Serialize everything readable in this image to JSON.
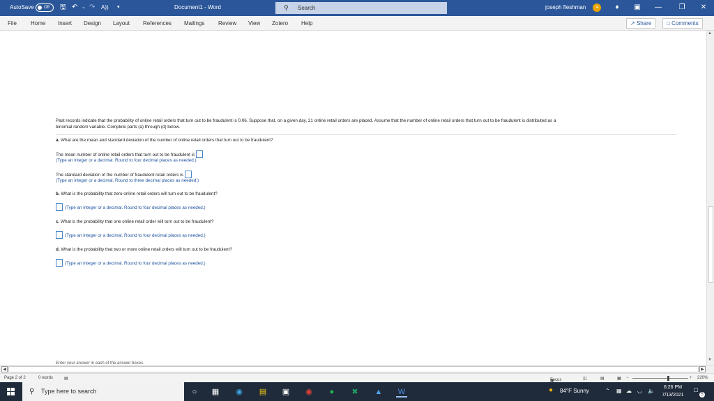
{
  "titlebar": {
    "autosave_label": "AutoSave",
    "autosave_state": "Off",
    "doc_title": "Document1  -  Word",
    "search_label": "Search",
    "user_name": "joseph fleshman",
    "user_initials": "JF"
  },
  "menu": {
    "tabs": [
      "File",
      "Home",
      "Insert",
      "Design",
      "Layout",
      "References",
      "Mailings",
      "Review",
      "View",
      "Zotero",
      "Help"
    ],
    "share_label": "Share",
    "comments_label": "Comments"
  },
  "document": {
    "intro_line1": "Past records indicate that the probability of online retail orders that turn out to be fraudulent is 0.06. Suppose that, on a given day, 21 online retail orders are placed. Assume that the number of online retail orders that turn out to be fraudulent is distributed as a",
    "intro_line2": "binomial random variable. Complete parts (a) through (d) below.",
    "qa_label": "a.",
    "qa_text": "What are the mean and standard deviation of the number of online retail orders that turn out to be fraudulent?",
    "mean_text": "The mean number of online retail orders that turn out to be fraudulent is",
    "mean_hint": "(Type an integer or a decimal. Round to four decimal places as needed.)",
    "sd_text": "The standard deviation of the number of fraudulent retail orders is",
    "sd_hint": "(Type an integer or a decimal. Round to three decimal places as needed.)",
    "qb_label": "b.",
    "qb_text": "What is the probability that zero online retail orders will turn out to be fraudulent?",
    "qb_hint": "(Type an integer or a decimal. Round to four decimal places as needed.)",
    "qc_label": "c.",
    "qc_text": "What is the probability that one online retail order will turn out to be fraudulent?",
    "qc_hint": "(Type an integer or a decimal. Round to four decimal places as needed.)",
    "qd_label": "d.",
    "qd_text": "What is the probability that two or more online retail orders will turn out to be fraudulent?",
    "qd_hint": "(Type an integer or a decimal. Round to four decimal places as needed.)",
    "cutoff_text": "Enter your answer in each of the answer boxes."
  },
  "statusbar": {
    "page": "Page 2 of 2",
    "words": "0 words",
    "focus": "Focus",
    "zoom": "220%"
  },
  "taskbar": {
    "search_placeholder": "Type here to search",
    "weather": "84°F  Sunny",
    "time": "6:26 PM",
    "date": "7/13/2021",
    "notification_count": "5"
  },
  "colors": {
    "word_blue": "#2b579a",
    "hint_blue": "#1a4f9c",
    "taskbar": "#1f2b3a"
  }
}
